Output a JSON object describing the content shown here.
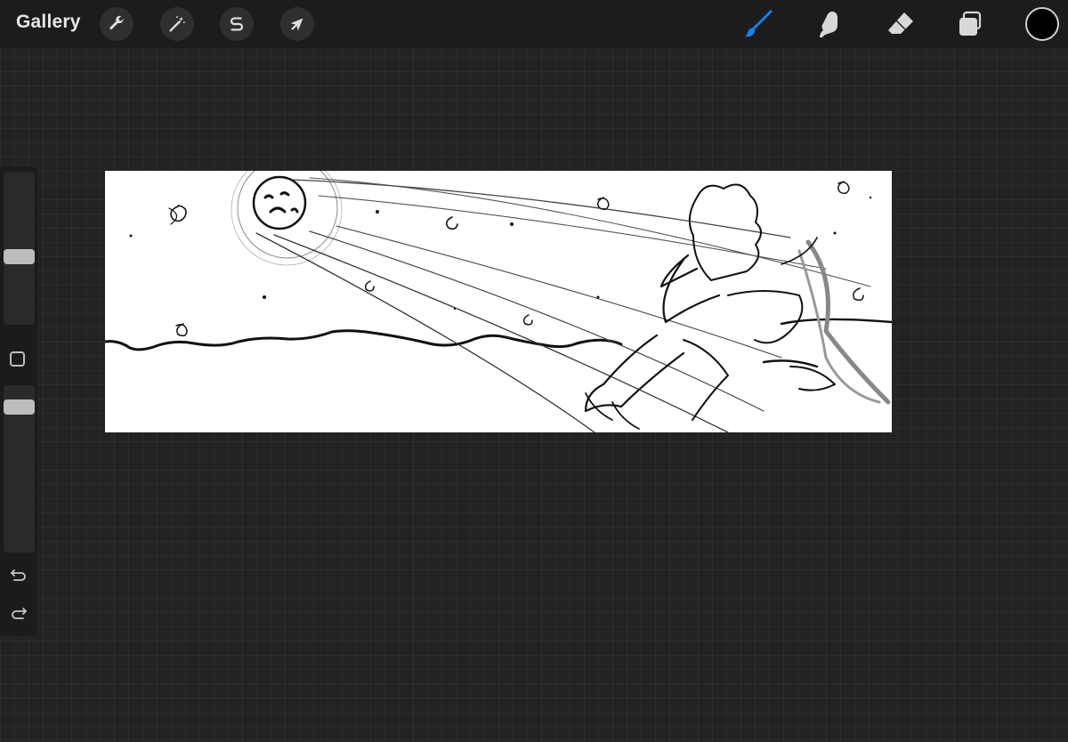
{
  "topbar": {
    "gallery_label": "Gallery",
    "left_tools": [
      {
        "name": "actions",
        "icon": "wrench-icon"
      },
      {
        "name": "adjustments",
        "icon": "magic-wand-icon"
      },
      {
        "name": "selection",
        "icon": "selection-s-icon"
      },
      {
        "name": "transform",
        "icon": "arrow-cursor-icon"
      }
    ],
    "right_tools": [
      {
        "name": "brush",
        "icon": "brush-icon",
        "active": true
      },
      {
        "name": "smudge",
        "icon": "smudge-finger-icon",
        "active": false
      },
      {
        "name": "eraser",
        "icon": "eraser-icon",
        "active": false
      },
      {
        "name": "layers",
        "icon": "layers-icon",
        "active": false
      }
    ],
    "current_color": "#000000",
    "active_tool_color": "#1a7ff0"
  },
  "sidebar": {
    "brush_size_level": 0.57,
    "opacity_level": 0.95,
    "icons": [
      "modify-square-icon",
      "undo-icon",
      "redo-icon"
    ]
  },
  "canvas": {
    "background": "#ffffff",
    "content": "sketch-artwork"
  }
}
